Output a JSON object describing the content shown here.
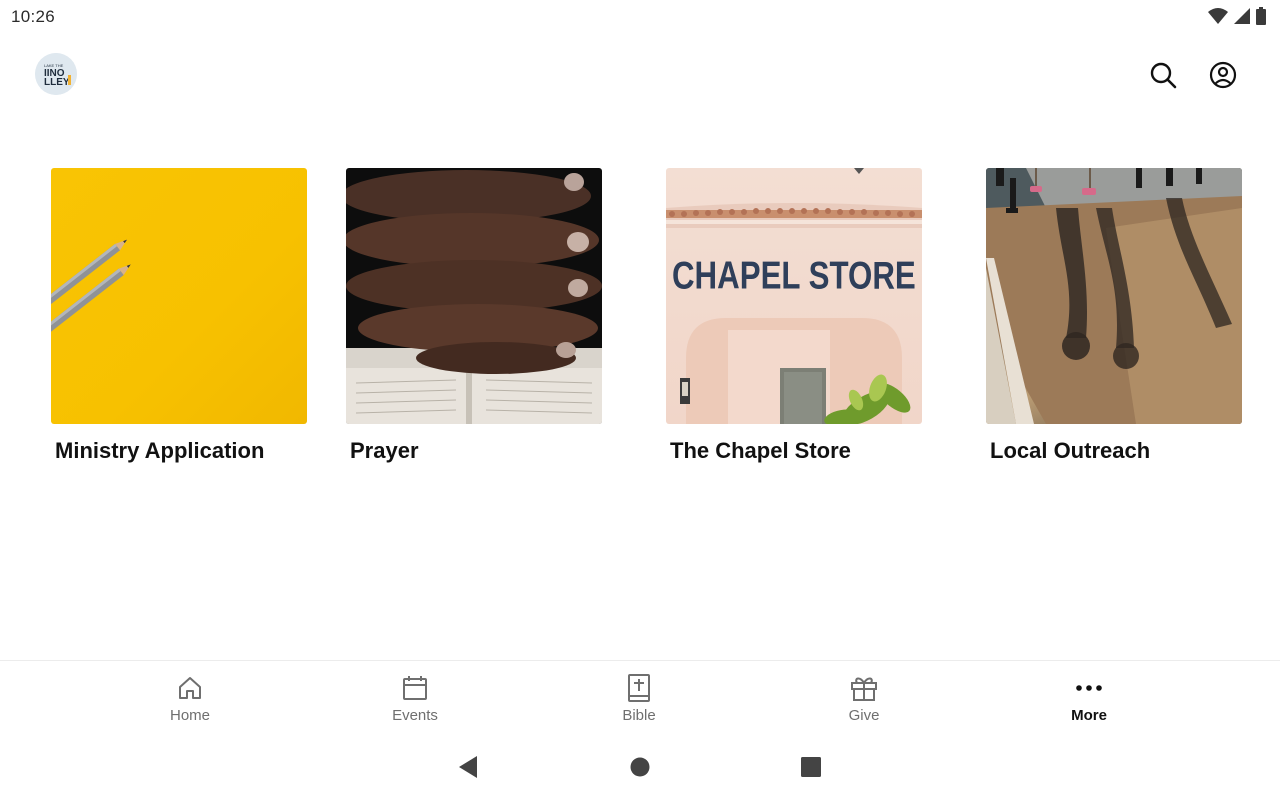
{
  "status_bar": {
    "time": "10:26"
  },
  "app_bar": {
    "logo_text": "LINO\nALLEY"
  },
  "tiles": [
    {
      "label": "Ministry Application"
    },
    {
      "label": "Prayer"
    },
    {
      "label": "The Chapel Store",
      "sign_text": "CHAPEL STORE"
    },
    {
      "label": "Local Outreach"
    }
  ],
  "bottom_nav": {
    "items": [
      {
        "label": "Home",
        "icon": "home-icon"
      },
      {
        "label": "Events",
        "icon": "calendar-icon"
      },
      {
        "label": "Bible",
        "icon": "bible-icon"
      },
      {
        "label": "Give",
        "icon": "gift-icon"
      },
      {
        "label": "More",
        "icon": "more-icon",
        "active": true
      }
    ]
  },
  "colors": {
    "accent": "#111111",
    "inactive": "#6f6f6f",
    "tile_yellow": "#f7c100"
  }
}
